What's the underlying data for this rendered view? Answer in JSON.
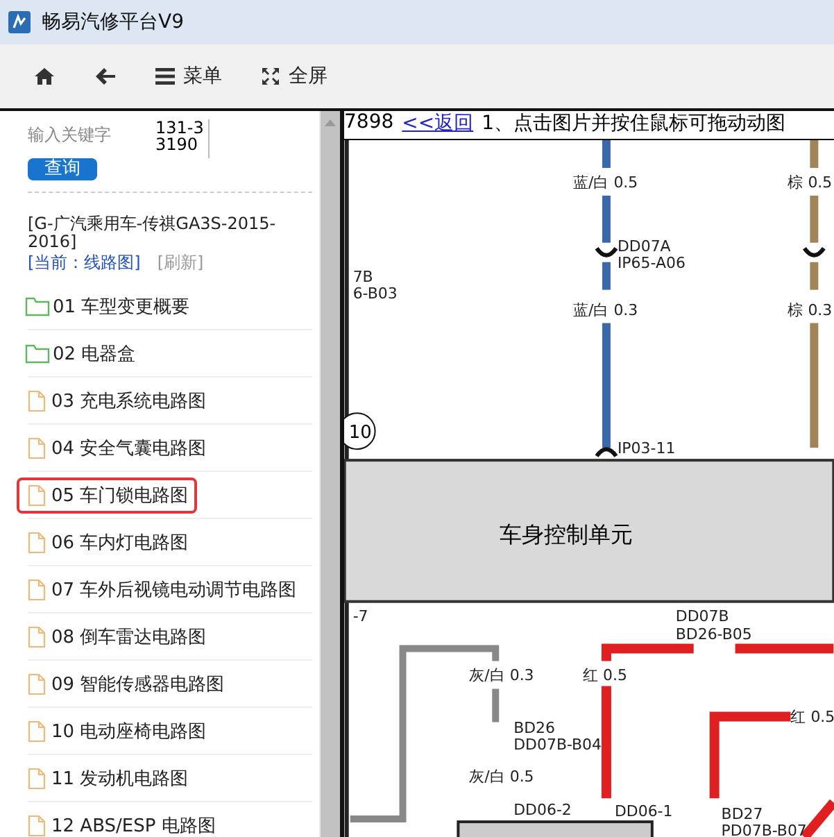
{
  "window": {
    "title": "畅易汽修平台V9"
  },
  "toolbar": [
    {
      "kind": "home"
    },
    {
      "kind": "back"
    },
    {
      "kind": "menu",
      "label": "菜单"
    },
    {
      "kind": "fullscreen",
      "label": "全屏"
    }
  ],
  "search": {
    "placeholder": "输入关键字",
    "code": "131-33190",
    "button": "查询"
  },
  "vehicle": {
    "name": "[G-广汽乘用车-传祺GA3S-2015-2016]",
    "current": "[当前：线路图]",
    "refresh": "[刷新]"
  },
  "tree": [
    {
      "kind": "folder",
      "label": "01 车型变更概要",
      "selected": false
    },
    {
      "kind": "folder",
      "label": "02 电器盒",
      "selected": false
    },
    {
      "kind": "file",
      "label": "03 充电系统电路图",
      "selected": false
    },
    {
      "kind": "file",
      "label": "04 安全气囊电路图",
      "selected": false
    },
    {
      "kind": "file",
      "label": "05 车门锁电路图",
      "selected": true
    },
    {
      "kind": "file",
      "label": "06 车内灯电路图",
      "selected": false
    },
    {
      "kind": "file",
      "label": "07 车外后视镜电动调节电路图",
      "selected": false
    },
    {
      "kind": "file",
      "label": "08 倒车雷达电路图",
      "selected": false
    },
    {
      "kind": "file",
      "label": "09 智能传感器电路图",
      "selected": false
    },
    {
      "kind": "file",
      "label": "10 电动座椅电路图",
      "selected": false
    },
    {
      "kind": "file",
      "label": "11 发动机电路图",
      "selected": false
    },
    {
      "kind": "file",
      "label": "12 ABS/ESP 电路图",
      "selected": false
    }
  ],
  "viewer": {
    "code": "7898",
    "back_link": "<<返回",
    "hint": "1、点击图片并按住鼠标可拖动动图"
  },
  "diagram": {
    "module": "车身控制单元",
    "connector": "10",
    "labels": [
      {
        "text": "蓝/白 0.5"
      },
      {
        "text": "棕 0.5"
      },
      {
        "text": "DD07A"
      },
      {
        "text": "IP65-A06"
      },
      {
        "text": "7B"
      },
      {
        "text": "6-B03"
      },
      {
        "text": "蓝/白 0.3"
      },
      {
        "text": "棕 0.3"
      },
      {
        "text": "IP03-11"
      },
      {
        "text": "-7"
      },
      {
        "text": "DD07B"
      },
      {
        "text": "BD26-B05"
      },
      {
        "text": "灰/白 0.3"
      },
      {
        "text": "红 0.5"
      },
      {
        "text": "红 0.5"
      },
      {
        "text": "BD26"
      },
      {
        "text": "DD07B-B04"
      },
      {
        "text": "灰/白 0.5"
      },
      {
        "text": "DD06-2"
      },
      {
        "text": "DD06-1"
      },
      {
        "text": "BD27"
      },
      {
        "text": "PD07B-B07"
      }
    ]
  }
}
